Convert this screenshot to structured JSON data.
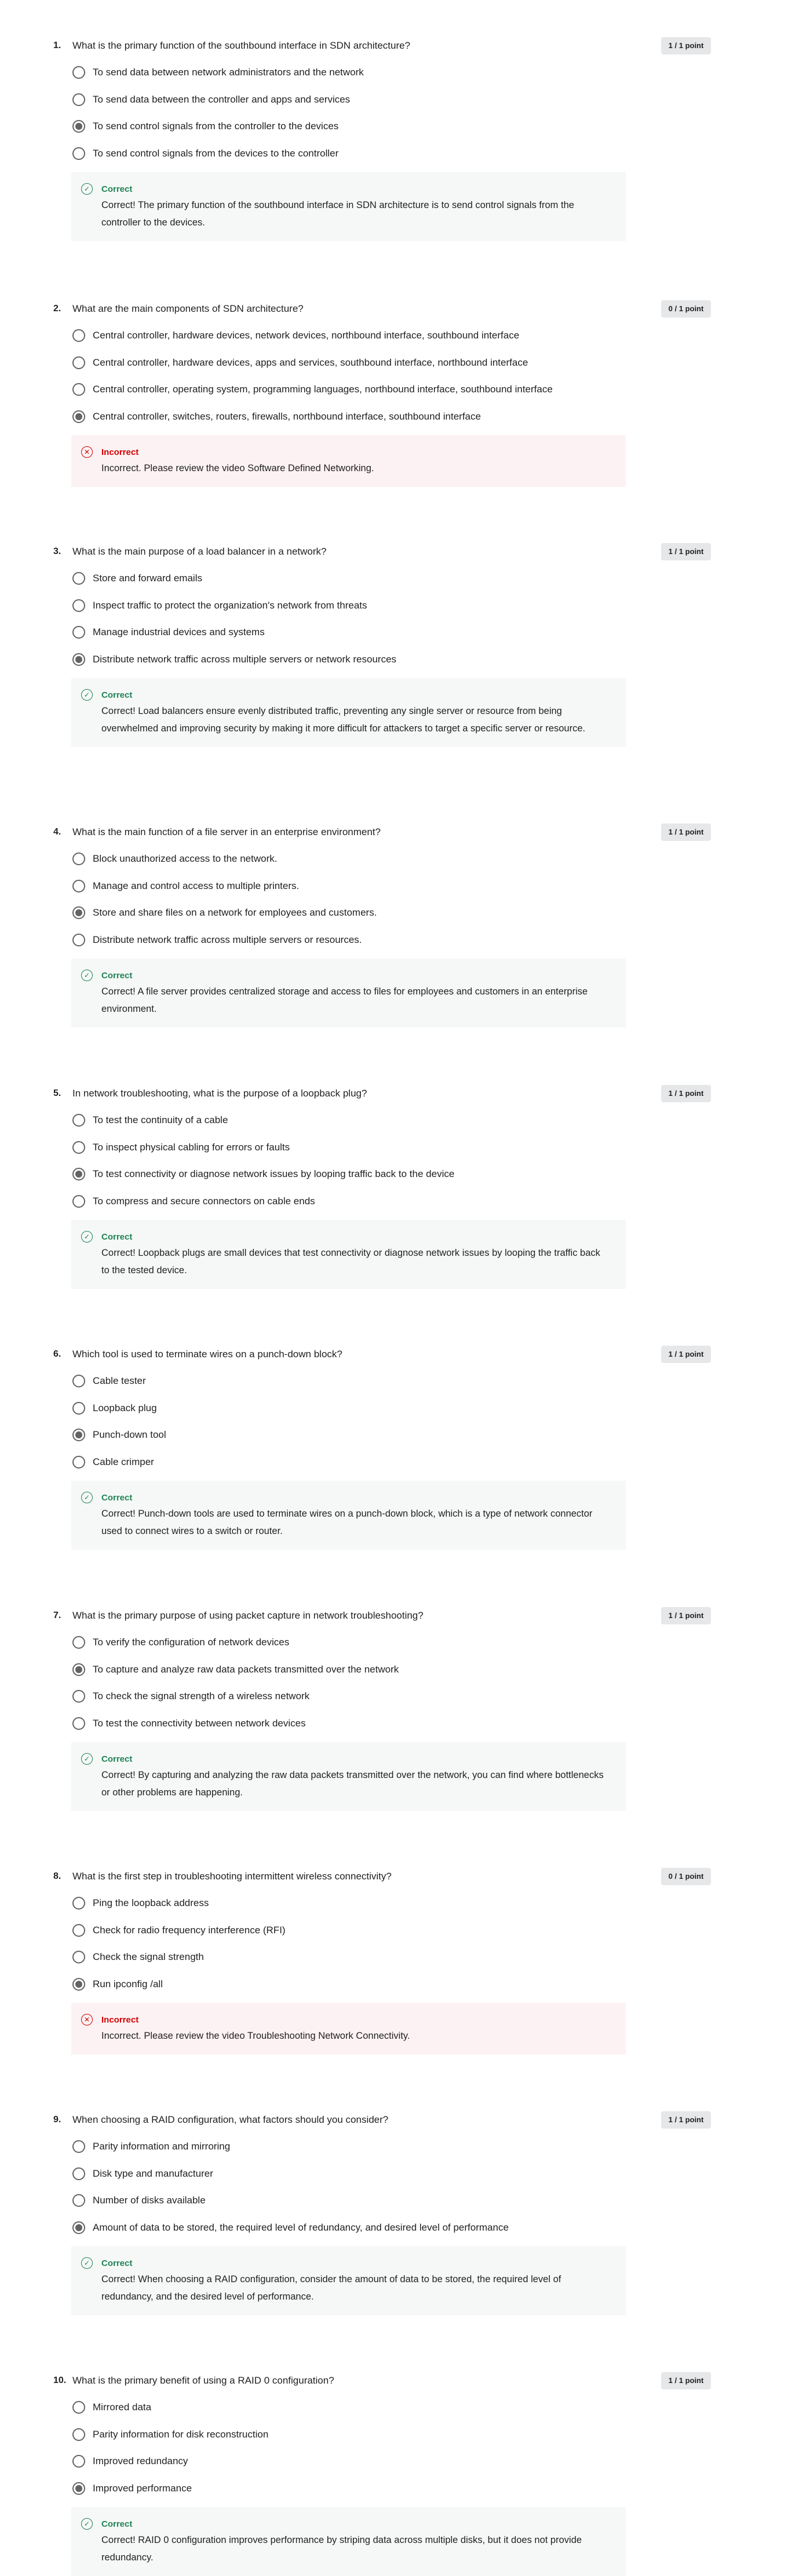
{
  "colors": {
    "correct": "#1f8354",
    "incorrect": "#d30001",
    "correct_bg": "#f5f8f7",
    "incorrect_bg": "#fcf2f3",
    "badge_bg": "#e6e7e9"
  },
  "icons": {
    "correct": "check-circle-icon",
    "incorrect": "x-circle-icon"
  },
  "questions": [
    {
      "number": "1.",
      "text": "What is the primary function of the southbound interface in SDN architecture?",
      "score": "1 / 1 point",
      "options": [
        "To send data between network administrators and the network",
        "To send data between the controller and apps and services",
        "To send control signals from the controller to the devices",
        "To send control signals from the devices to the controller"
      ],
      "selected": 2,
      "feedback": {
        "status": "correct",
        "label": "Correct",
        "text": "Correct! The primary function of the southbound interface in SDN architecture is to send control signals from the controller to the devices."
      }
    },
    {
      "number": "2.",
      "text": "What are the main components of SDN architecture?",
      "score": "0 / 1 point",
      "options": [
        "Central controller, hardware devices, network devices, northbound interface, southbound interface",
        "Central controller, hardware devices, apps and services, southbound interface, northbound interface",
        "Central controller, operating system, programming languages, northbound interface, southbound interface",
        "Central controller, switches, routers, firewalls, northbound interface, southbound interface"
      ],
      "selected": 3,
      "feedback": {
        "status": "incorrect",
        "label": "Incorrect",
        "text": "Incorrect. Please review the video Software Defined Networking."
      }
    },
    {
      "number": "3.",
      "text": "What is the main purpose of a load balancer in a network?",
      "score": "1 / 1 point",
      "options": [
        "Store and forward emails",
        "Inspect traffic to protect the organization's network from threats",
        "Manage industrial devices and systems",
        "Distribute network traffic across multiple servers or network resources"
      ],
      "selected": 3,
      "feedback": {
        "status": "correct",
        "label": "Correct",
        "text": "Correct! Load balancers ensure evenly distributed traffic, preventing any single server or resource from being overwhelmed and improving security by making it more difficult for attackers to target a specific server or resource."
      }
    },
    {
      "number": "4.",
      "text": "What is the main function of a file server in an enterprise environment?",
      "score": "1 / 1 point",
      "options": [
        "Block unauthorized access to the network.",
        "Manage and control access to multiple printers.",
        "Store and share files on a network for employees and customers.",
        "Distribute network traffic across multiple servers or resources."
      ],
      "selected": 2,
      "feedback": {
        "status": "correct",
        "label": "Correct",
        "text": "Correct! A file server provides centralized storage and access to files for employees and customers in an enterprise environment."
      }
    },
    {
      "number": "5.",
      "text": "In network troubleshooting, what is the purpose of a loopback plug?",
      "score": "1 / 1 point",
      "options": [
        "To test the continuity of a cable",
        "To inspect physical cabling for errors or faults",
        "To test connectivity or diagnose network issues by looping traffic back to the device",
        "To compress and secure connectors on cable ends"
      ],
      "selected": 2,
      "feedback": {
        "status": "correct",
        "label": "Correct",
        "text": "Correct! Loopback plugs are small devices that test connectivity or diagnose network issues by looping the traffic back to the tested device."
      }
    },
    {
      "number": "6.",
      "text": "Which tool is used to terminate wires on a punch-down block?",
      "score": "1 / 1 point",
      "options": [
        "Cable tester",
        "Loopback plug",
        "Punch-down tool",
        "Cable crimper"
      ],
      "selected": 2,
      "feedback": {
        "status": "correct",
        "label": "Correct",
        "text": "Correct! Punch-down tools are used to terminate wires on a punch-down block, which is a type of network connector used to connect wires to a switch or router."
      }
    },
    {
      "number": "7.",
      "text": "What is the primary purpose of using packet capture in network troubleshooting?",
      "score": "1 / 1 point",
      "options": [
        "To verify the configuration of network devices",
        "To capture and analyze raw data packets transmitted over the network",
        "To check the signal strength of a wireless network",
        "To test the connectivity between network devices"
      ],
      "selected": 1,
      "feedback": {
        "status": "correct",
        "label": "Correct",
        "text": "Correct! By capturing and analyzing the raw data packets transmitted over the network, you can find where bottlenecks or other problems are happening."
      }
    },
    {
      "number": "8.",
      "text": "What is the first step in troubleshooting intermittent wireless connectivity?",
      "score": "0 / 1 point",
      "options": [
        "Ping the loopback address",
        "Check for radio frequency interference (RFI)",
        "Check the signal strength",
        "Run ipconfig /all"
      ],
      "selected": 3,
      "feedback": {
        "status": "incorrect",
        "label": "Incorrect",
        "text": "Incorrect. Please review the video Troubleshooting Network Connectivity."
      }
    },
    {
      "number": "9.",
      "text": "When choosing a RAID configuration, what factors should you consider?",
      "score": "1 / 1 point",
      "options": [
        "Parity information and mirroring",
        "Disk type and manufacturer",
        "Number of disks available",
        "Amount of data to be stored, the required level of redundancy, and desired level of performance"
      ],
      "selected": 3,
      "feedback": {
        "status": "correct",
        "label": "Correct",
        "text": "Correct! When choosing a RAID configuration, consider the amount of data to be stored, the required level of redundancy, and the desired level of performance."
      }
    },
    {
      "number": "10.",
      "text": "What is the primary benefit of using a RAID 0 configuration?",
      "score": "1 / 1 point",
      "options": [
        "Mirrored data",
        "Parity information for disk reconstruction",
        "Improved redundancy",
        "Improved performance"
      ],
      "selected": 3,
      "feedback": {
        "status": "correct",
        "label": "Correct",
        "text": "Correct! RAID 0 configuration improves performance by striping data across multiple disks, but it does not provide redundancy."
      }
    }
  ]
}
